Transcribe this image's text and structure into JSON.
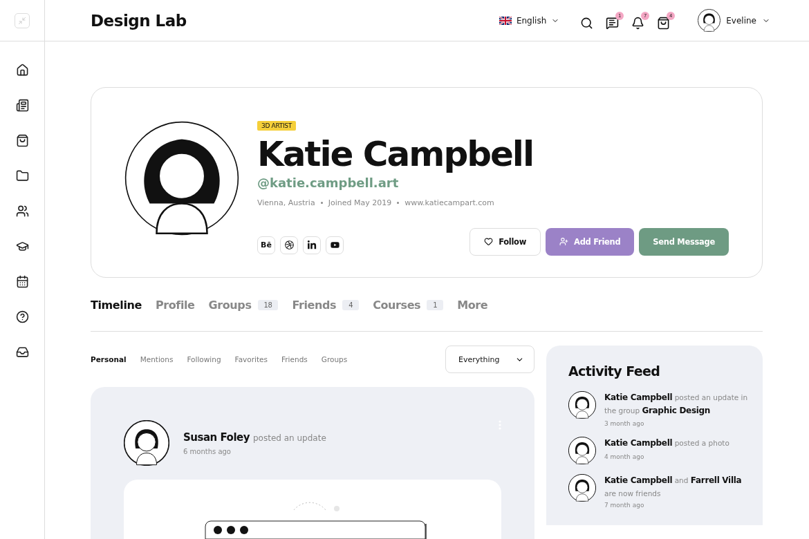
{
  "header": {
    "brand": "Design Lab",
    "language": "English",
    "badges": {
      "messages": "1",
      "notifications": "7",
      "cart": "4"
    },
    "user": "Eveline"
  },
  "sidebar": {
    "items": [
      {
        "kind": "home"
      },
      {
        "kind": "news"
      },
      {
        "kind": "shop"
      },
      {
        "kind": "folder"
      },
      {
        "kind": "people"
      },
      {
        "kind": "courses"
      },
      {
        "kind": "calendar"
      },
      {
        "kind": "help"
      },
      {
        "kind": "inbox"
      }
    ]
  },
  "profile": {
    "tag": "3D ARTIST",
    "name": "Katie Campbell",
    "handle": "@katie.campbell.art",
    "meta": [
      "Vienna, Austria",
      "Joined May 2019",
      "www.katiecampart.com"
    ],
    "socials": [
      {
        "kind": "behance",
        "label": "Bē"
      },
      {
        "kind": "dribbble"
      },
      {
        "kind": "linkedin"
      },
      {
        "kind": "youtube"
      }
    ],
    "buttons": [
      {
        "kind": "follow",
        "label": "Follow"
      },
      {
        "kind": "add",
        "label": "Add Friend"
      },
      {
        "kind": "message",
        "label": "Send Message"
      }
    ]
  },
  "tabs": [
    {
      "label": "Timeline",
      "selected": true
    },
    {
      "label": "Profile",
      "selected": false
    },
    {
      "label": "Groups",
      "count": "18",
      "selected": false
    },
    {
      "label": "Friends",
      "count": "4",
      "selected": false
    },
    {
      "label": "Courses",
      "count": "1",
      "selected": false
    },
    {
      "label": "More",
      "selected": false
    }
  ],
  "subtabs": [
    {
      "label": "Personal",
      "selected": true
    },
    {
      "label": "Mentions",
      "selected": false
    },
    {
      "label": "Following",
      "selected": false
    },
    {
      "label": "Favorites",
      "selected": false
    },
    {
      "label": "Friends",
      "selected": false
    },
    {
      "label": "Groups",
      "selected": false
    }
  ],
  "filter": {
    "value": "Everything"
  },
  "post": {
    "author": "Susan Foley",
    "action": "posted an update",
    "time": "6 months ago"
  },
  "activity_feed": {
    "title": "Activity Feed",
    "items": [
      {
        "text": "**Katie Campbell** posted an update in the group **Graphic Design**",
        "time": "3 month ago"
      },
      {
        "text": "**Katie Campbell** posted a photo",
        "time": "4 month ago"
      },
      {
        "text": "**Katie Campbell** and **Farrell Villa** are now friends",
        "time": "7 month ago"
      }
    ]
  }
}
